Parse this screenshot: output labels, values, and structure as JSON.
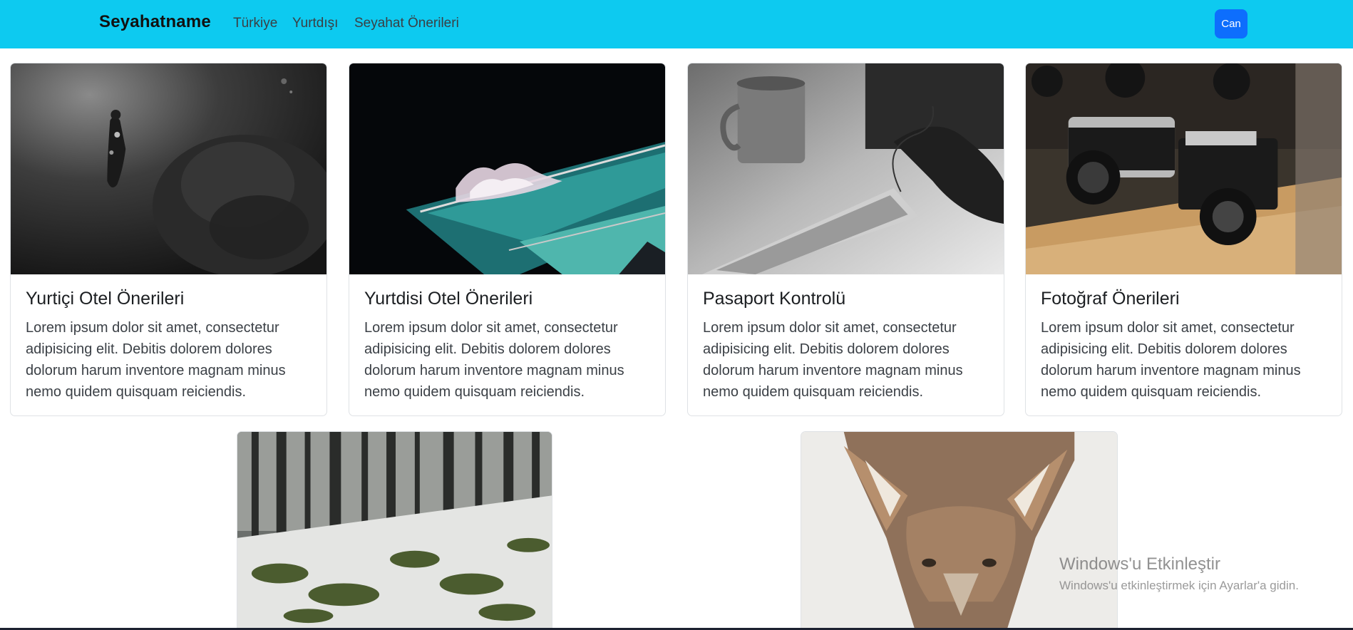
{
  "navbar": {
    "brand": "Seyahatname",
    "links": [
      "Türkiye",
      "Yurtdışı",
      "Seyahat Önerileri"
    ],
    "user_button": "Can",
    "bg_color": "#0dcaf0",
    "button_color": "#0d6efd"
  },
  "cards": [
    {
      "title": "Yurtiçi Otel Önerileri",
      "text": "Lorem ipsum dolor sit amet, consectetur adipisicing elit. Debitis dolorem dolores dolorum harum inventore magnam minus nemo quidem quisquam reiciendis.",
      "image": "underwater-diver-photo"
    },
    {
      "title": "Yurtdisi Otel Önerileri",
      "text": "Lorem ipsum dolor sit amet, consectetur adipisicing elit. Debitis dolorem dolores dolorum harum inventore magnam minus nemo quidem quisquam reiciendis.",
      "image": "night-pool-photo"
    },
    {
      "title": "Pasaport Kontrolü",
      "text": "Lorem ipsum dolor sit amet, consectetur adipisicing elit. Debitis dolorem dolores dolorum harum inventore magnam minus nemo quidem quisquam reiciendis.",
      "image": "keyboard-mug-photo"
    },
    {
      "title": "Fotoğraf Önerileri",
      "text": "Lorem ipsum dolor sit amet, consectetur adipisicing elit. Debitis dolorem dolores dolorum harum inventore magnam minus nemo quidem quisquam reiciendis.",
      "image": "vintage-cameras-photo"
    }
  ],
  "bottom_images": [
    "snowy-forest-photo",
    "fox-photo"
  ],
  "watermark": {
    "title": "Windows'u Etkinleştir",
    "subtitle": "Windows'u etkinleştirmek için Ayarlar'a gidin."
  }
}
